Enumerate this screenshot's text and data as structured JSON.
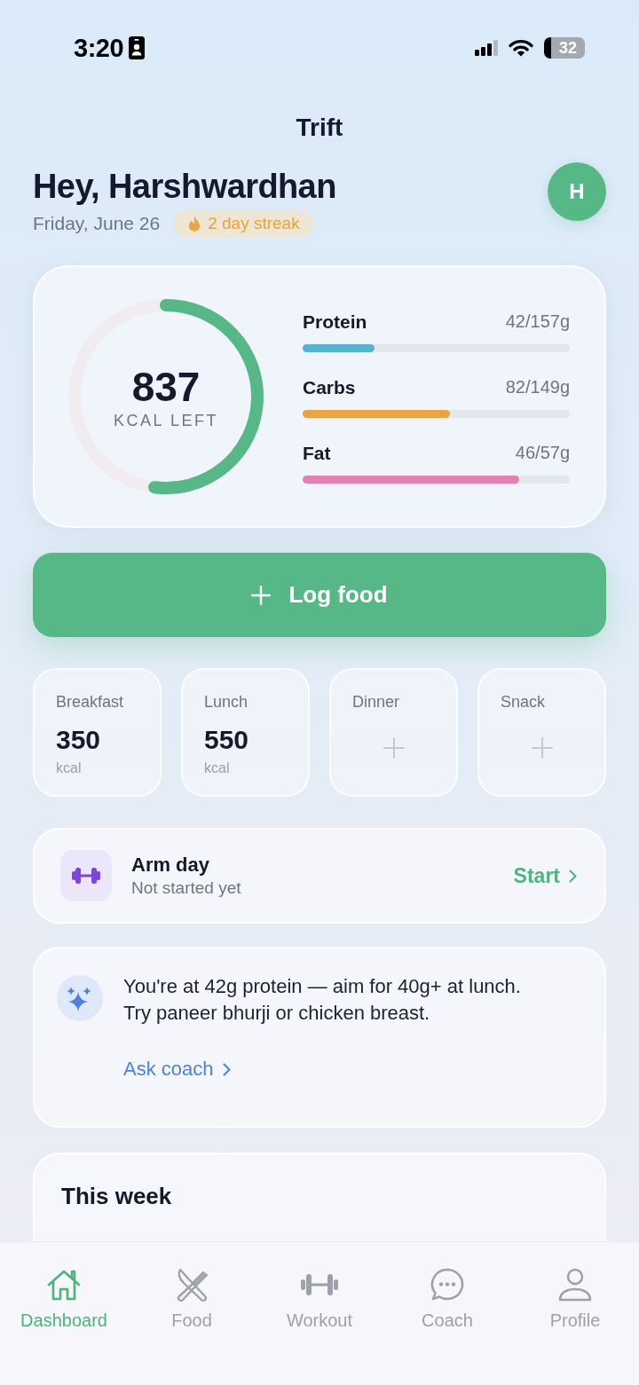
{
  "status_bar": {
    "time": "3:20",
    "battery": "32"
  },
  "header": {
    "title": "Trift",
    "greeting": "Hey, Harshwardhan",
    "date": "Friday, June 26",
    "streak": "2 day streak",
    "avatar": "H"
  },
  "calories": {
    "value": "837",
    "label": "KCAL LEFT",
    "level": 0.52
  },
  "macros": [
    {
      "name": "Protein",
      "reading": "42/157g",
      "level": 0.27,
      "color": "#52b4d3"
    },
    {
      "name": "Carbs",
      "reading": "82/149g",
      "level": 0.55,
      "color": "#eba441"
    },
    {
      "name": "Fat",
      "reading": "46/57g",
      "level": 0.81,
      "color": "#e67fb6"
    }
  ],
  "log_button": {
    "label": "Log food"
  },
  "meals": [
    {
      "name": "Breakfast",
      "kind": "logged",
      "value": "350",
      "unit": "kcal"
    },
    {
      "name": "Lunch",
      "kind": "logged",
      "value": "550",
      "unit": "kcal"
    },
    {
      "name": "Dinner",
      "kind": "empty"
    },
    {
      "name": "Snack",
      "kind": "empty"
    }
  ],
  "workout": {
    "title": "Arm day",
    "status": "Not started yet",
    "action": "Start"
  },
  "coach_tip": {
    "text": "You're at 42g protein — aim for 40g+ at lunch. Try paneer bhurji or chicken breast.",
    "link": "Ask coach"
  },
  "week": {
    "title": "This week"
  },
  "tabs": [
    {
      "label": "Dashboard",
      "selected": true
    },
    {
      "label": "Food",
      "selected": false
    },
    {
      "label": "Workout",
      "selected": false
    },
    {
      "label": "Coach",
      "selected": false
    },
    {
      "label": "Profile",
      "selected": false
    }
  ]
}
